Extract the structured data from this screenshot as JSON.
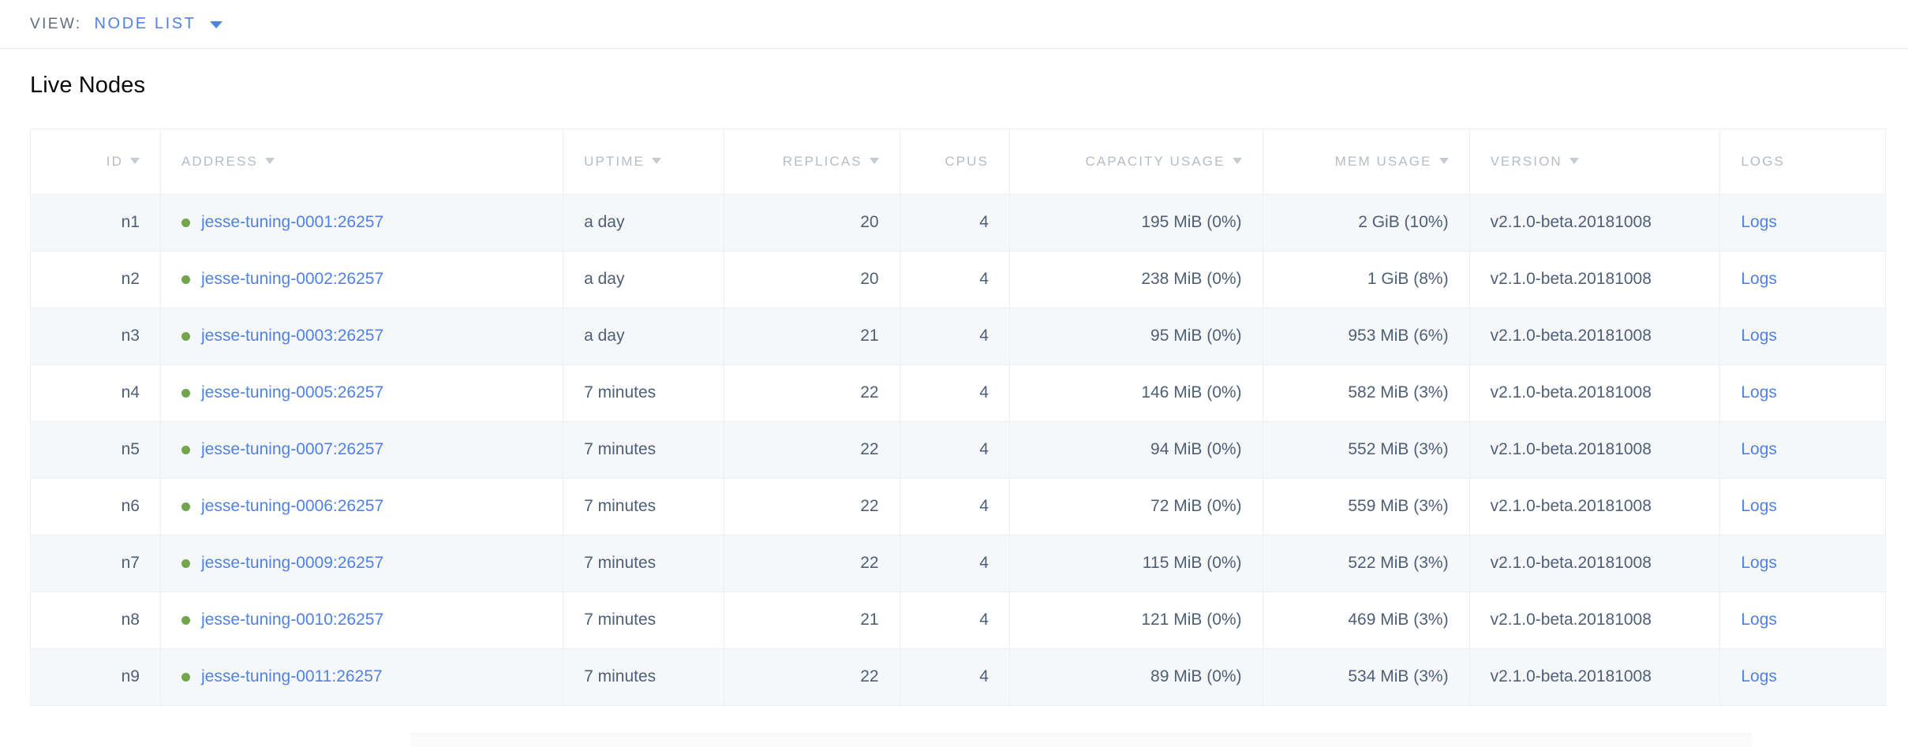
{
  "view_bar": {
    "label": "VIEW:",
    "selected": "NODE LIST",
    "caret_icon": "chevron-down-icon"
  },
  "page": {
    "title": "Live Nodes"
  },
  "colors": {
    "link": "#4f82e8",
    "status_live": "#71a74a",
    "header_text": "#b4bcc4",
    "cell_text": "#4e5f78",
    "row_stripe": "#f6f7f8",
    "border": "#eceff2"
  },
  "table": {
    "columns": [
      {
        "key": "id",
        "label": "ID",
        "sortable": true,
        "align": "right"
      },
      {
        "key": "address",
        "label": "ADDRESS",
        "sortable": true,
        "align": "left"
      },
      {
        "key": "uptime",
        "label": "UPTIME",
        "sortable": true,
        "align": "left"
      },
      {
        "key": "replicas",
        "label": "REPLICAS",
        "sortable": true,
        "align": "right"
      },
      {
        "key": "cpus",
        "label": "CPUS",
        "sortable": false,
        "align": "right"
      },
      {
        "key": "capacity",
        "label": "CAPACITY USAGE",
        "sortable": true,
        "align": "right"
      },
      {
        "key": "mem",
        "label": "MEM USAGE",
        "sortable": true,
        "align": "right"
      },
      {
        "key": "version",
        "label": "VERSION",
        "sortable": true,
        "align": "left"
      },
      {
        "key": "logs",
        "label": "LOGS",
        "sortable": false,
        "align": "left"
      }
    ],
    "rows": [
      {
        "id": "n1",
        "status": "live",
        "address": "jesse-tuning-0001:26257",
        "uptime": "a day",
        "replicas": "20",
        "cpus": "4",
        "capacity": "195 MiB (0%)",
        "mem": "2 GiB (10%)",
        "version": "v2.1.0-beta.20181008",
        "logs": "Logs"
      },
      {
        "id": "n2",
        "status": "live",
        "address": "jesse-tuning-0002:26257",
        "uptime": "a day",
        "replicas": "20",
        "cpus": "4",
        "capacity": "238 MiB (0%)",
        "mem": "1 GiB (8%)",
        "version": "v2.1.0-beta.20181008",
        "logs": "Logs"
      },
      {
        "id": "n3",
        "status": "live",
        "address": "jesse-tuning-0003:26257",
        "uptime": "a day",
        "replicas": "21",
        "cpus": "4",
        "capacity": "95 MiB (0%)",
        "mem": "953 MiB (6%)",
        "version": "v2.1.0-beta.20181008",
        "logs": "Logs"
      },
      {
        "id": "n4",
        "status": "live",
        "address": "jesse-tuning-0005:26257",
        "uptime": "7 minutes",
        "replicas": "22",
        "cpus": "4",
        "capacity": "146 MiB (0%)",
        "mem": "582 MiB (3%)",
        "version": "v2.1.0-beta.20181008",
        "logs": "Logs"
      },
      {
        "id": "n5",
        "status": "live",
        "address": "jesse-tuning-0007:26257",
        "uptime": "7 minutes",
        "replicas": "22",
        "cpus": "4",
        "capacity": "94 MiB (0%)",
        "mem": "552 MiB (3%)",
        "version": "v2.1.0-beta.20181008",
        "logs": "Logs"
      },
      {
        "id": "n6",
        "status": "live",
        "address": "jesse-tuning-0006:26257",
        "uptime": "7 minutes",
        "replicas": "22",
        "cpus": "4",
        "capacity": "72 MiB (0%)",
        "mem": "559 MiB (3%)",
        "version": "v2.1.0-beta.20181008",
        "logs": "Logs"
      },
      {
        "id": "n7",
        "status": "live",
        "address": "jesse-tuning-0009:26257",
        "uptime": "7 minutes",
        "replicas": "22",
        "cpus": "4",
        "capacity": "115 MiB (0%)",
        "mem": "522 MiB (3%)",
        "version": "v2.1.0-beta.20181008",
        "logs": "Logs"
      },
      {
        "id": "n8",
        "status": "live",
        "address": "jesse-tuning-0010:26257",
        "uptime": "7 minutes",
        "replicas": "21",
        "cpus": "4",
        "capacity": "121 MiB (0%)",
        "mem": "469 MiB (3%)",
        "version": "v2.1.0-beta.20181008",
        "logs": "Logs"
      },
      {
        "id": "n9",
        "status": "live",
        "address": "jesse-tuning-0011:26257",
        "uptime": "7 minutes",
        "replicas": "22",
        "cpus": "4",
        "capacity": "89 MiB (0%)",
        "mem": "534 MiB (3%)",
        "version": "v2.1.0-beta.20181008",
        "logs": "Logs"
      }
    ]
  }
}
